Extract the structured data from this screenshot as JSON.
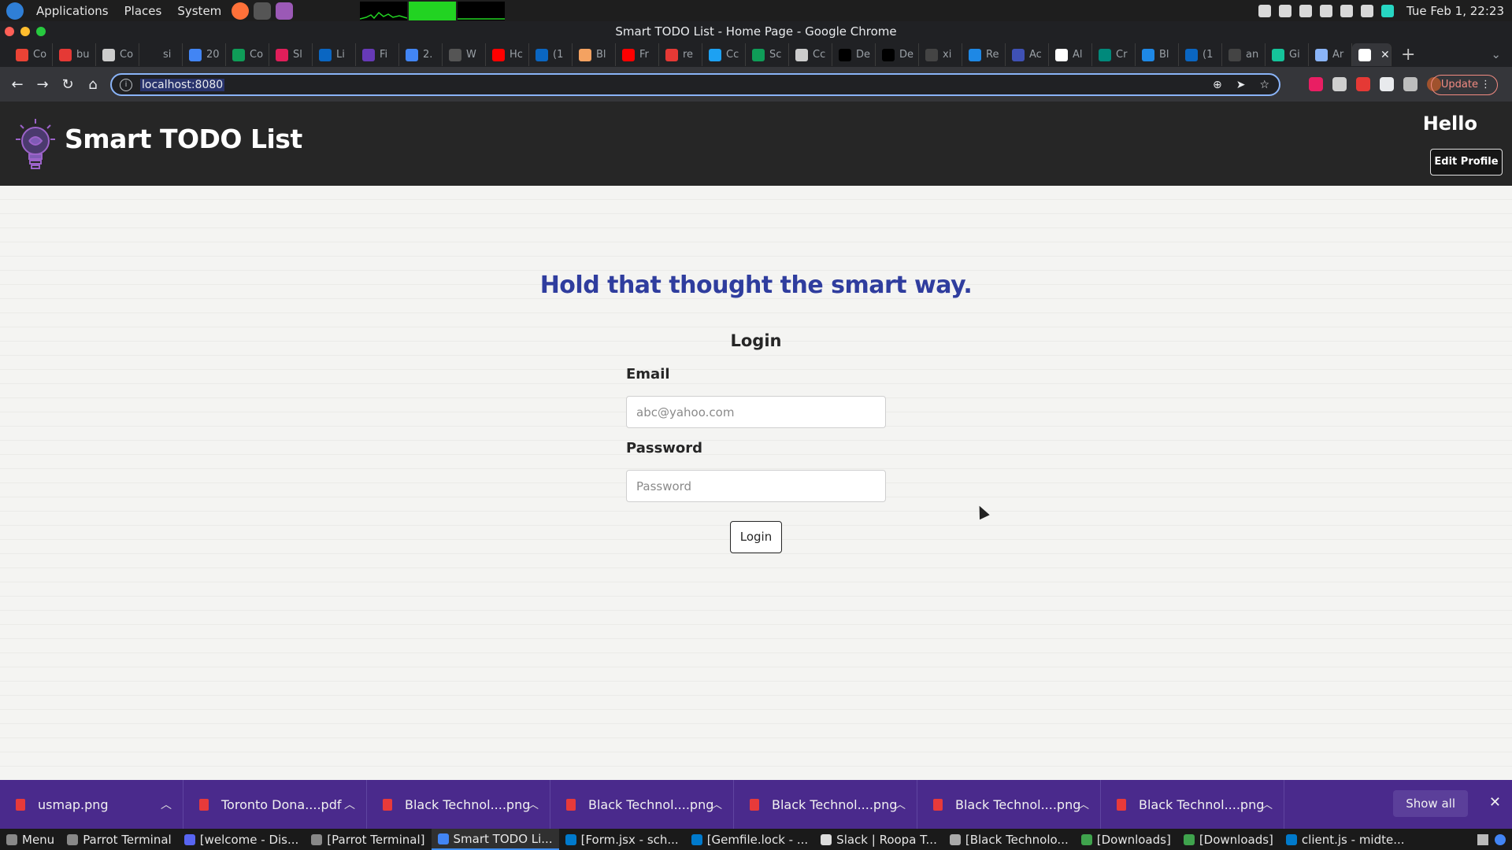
{
  "os": {
    "menus": [
      "Applications",
      "Places",
      "System"
    ],
    "clock": "Tue Feb 1, 22:23"
  },
  "window": {
    "title": "Smart TODO List - Home Page - Google Chrome"
  },
  "tabs": [
    {
      "label": "Co",
      "favicon": "gmail-icon",
      "color": "#ea4335"
    },
    {
      "label": "bu",
      "favicon": "circle-icon",
      "color": "#e53935"
    },
    {
      "label": "Co",
      "favicon": "github-icon",
      "color": "#cccccc"
    },
    {
      "label": "si",
      "favicon": "blank-icon",
      "color": "#202124"
    },
    {
      "label": "20",
      "favicon": "docs-icon",
      "color": "#4285f4"
    },
    {
      "label": "Co",
      "favicon": "sheets-icon",
      "color": "#0f9d58"
    },
    {
      "label": "Sl",
      "favicon": "slack-icon",
      "color": "#e01e5a"
    },
    {
      "label": "Li",
      "favicon": "linkedin-icon",
      "color": "#0a66c2"
    },
    {
      "label": "Fi",
      "favicon": "forms-icon",
      "color": "#673ab7"
    },
    {
      "label": "2.",
      "favicon": "docs-icon",
      "color": "#4285f4"
    },
    {
      "label": "W",
      "favicon": "dash-icon",
      "color": "#555555"
    },
    {
      "label": "Hc",
      "favicon": "youtube-icon",
      "color": "#ff0000"
    },
    {
      "label": "(1",
      "favicon": "linkedin-icon",
      "color": "#0a66c2"
    },
    {
      "label": "Bl",
      "favicon": "avatar-icon",
      "color": "#f4a261"
    },
    {
      "label": "Fr",
      "favicon": "youtube-icon",
      "color": "#ff0000"
    },
    {
      "label": "re",
      "favicon": "record-icon",
      "color": "#e53935"
    },
    {
      "label": "Cc",
      "favicon": "twitter-icon",
      "color": "#1da1f2"
    },
    {
      "label": "Sc",
      "favicon": "sheets-icon",
      "color": "#0f9d58"
    },
    {
      "label": "Cc",
      "favicon": "github-icon",
      "color": "#cccccc"
    },
    {
      "label": "De",
      "favicon": "dev-icon",
      "color": "#000000"
    },
    {
      "label": "De",
      "favicon": "dev-icon",
      "color": "#000000"
    },
    {
      "label": "xi",
      "favicon": "github-icon",
      "color": "#444444"
    },
    {
      "label": "Re",
      "favicon": "box-icon",
      "color": "#1e88e5"
    },
    {
      "label": "Ac",
      "favicon": "cube-icon",
      "color": "#3f51b5"
    },
    {
      "label": "Al",
      "favicon": "chrome-icon",
      "color": "#ffffff"
    },
    {
      "label": "Cr",
      "favicon": "c-icon",
      "color": "#00897b"
    },
    {
      "label": "Bl",
      "favicon": "c-icon",
      "color": "#1e88e5"
    },
    {
      "label": "(1",
      "favicon": "linkedin-icon",
      "color": "#0a66c2"
    },
    {
      "label": "an",
      "favicon": "github-icon",
      "color": "#444444"
    },
    {
      "label": "Gi",
      "favicon": "grammarly-icon",
      "color": "#15c39a"
    },
    {
      "label": "Ar",
      "favicon": "graph-icon",
      "color": "#8ab4f8"
    },
    {
      "label": "",
      "favicon": "chrome-icon",
      "color": "#ffffff",
      "active": true
    }
  ],
  "toolbar": {
    "url": "localhost:8080",
    "update_label": "Update"
  },
  "app": {
    "title": "Smart TODO List",
    "greeting": "Hello",
    "edit_profile": "Edit Profile",
    "tagline": "Hold that thought the smart way.",
    "login_heading": "Login",
    "email_label": "Email",
    "email_placeholder": "abc@yahoo.com",
    "password_label": "Password",
    "password_placeholder": "Password",
    "login_button": "Login"
  },
  "downloads": {
    "items": [
      "usmap.png",
      "Toronto Dona....pdf",
      "Black Technol....png",
      "Black Technol....png",
      "Black Technol....png",
      "Black Technol....png",
      "Black Technol....png"
    ],
    "show_all": "Show all"
  },
  "taskbar": {
    "menu": "Menu",
    "tasks": [
      {
        "label": "Parrot Terminal",
        "icon": "terminal-icon",
        "color": "#888888"
      },
      {
        "label": "[welcome - Dis...",
        "icon": "discord-icon",
        "color": "#5865f2"
      },
      {
        "label": "[Parrot Terminal]",
        "icon": "terminal-icon",
        "color": "#888888"
      },
      {
        "label": "Smart TODO Li...",
        "icon": "chrome-icon",
        "color": "#4285f4",
        "active": true
      },
      {
        "label": "[Form.jsx - sch...",
        "icon": "vscode-icon",
        "color": "#007acc"
      },
      {
        "label": "[Gemfile.lock - ...",
        "icon": "vscode-icon",
        "color": "#007acc"
      },
      {
        "label": "Slack | Roopa T...",
        "icon": "slack-icon",
        "color": "#dddddd"
      },
      {
        "label": "[Black Technolo...",
        "icon": "dash-icon",
        "color": "#aaaaaa"
      },
      {
        "label": "[Downloads]",
        "icon": "folder-icon",
        "color": "#3fa34d"
      },
      {
        "label": "[Downloads]",
        "icon": "folder-icon",
        "color": "#3fa34d"
      },
      {
        "label": "client.js - midte...",
        "icon": "vscode-icon",
        "color": "#007acc"
      }
    ]
  }
}
